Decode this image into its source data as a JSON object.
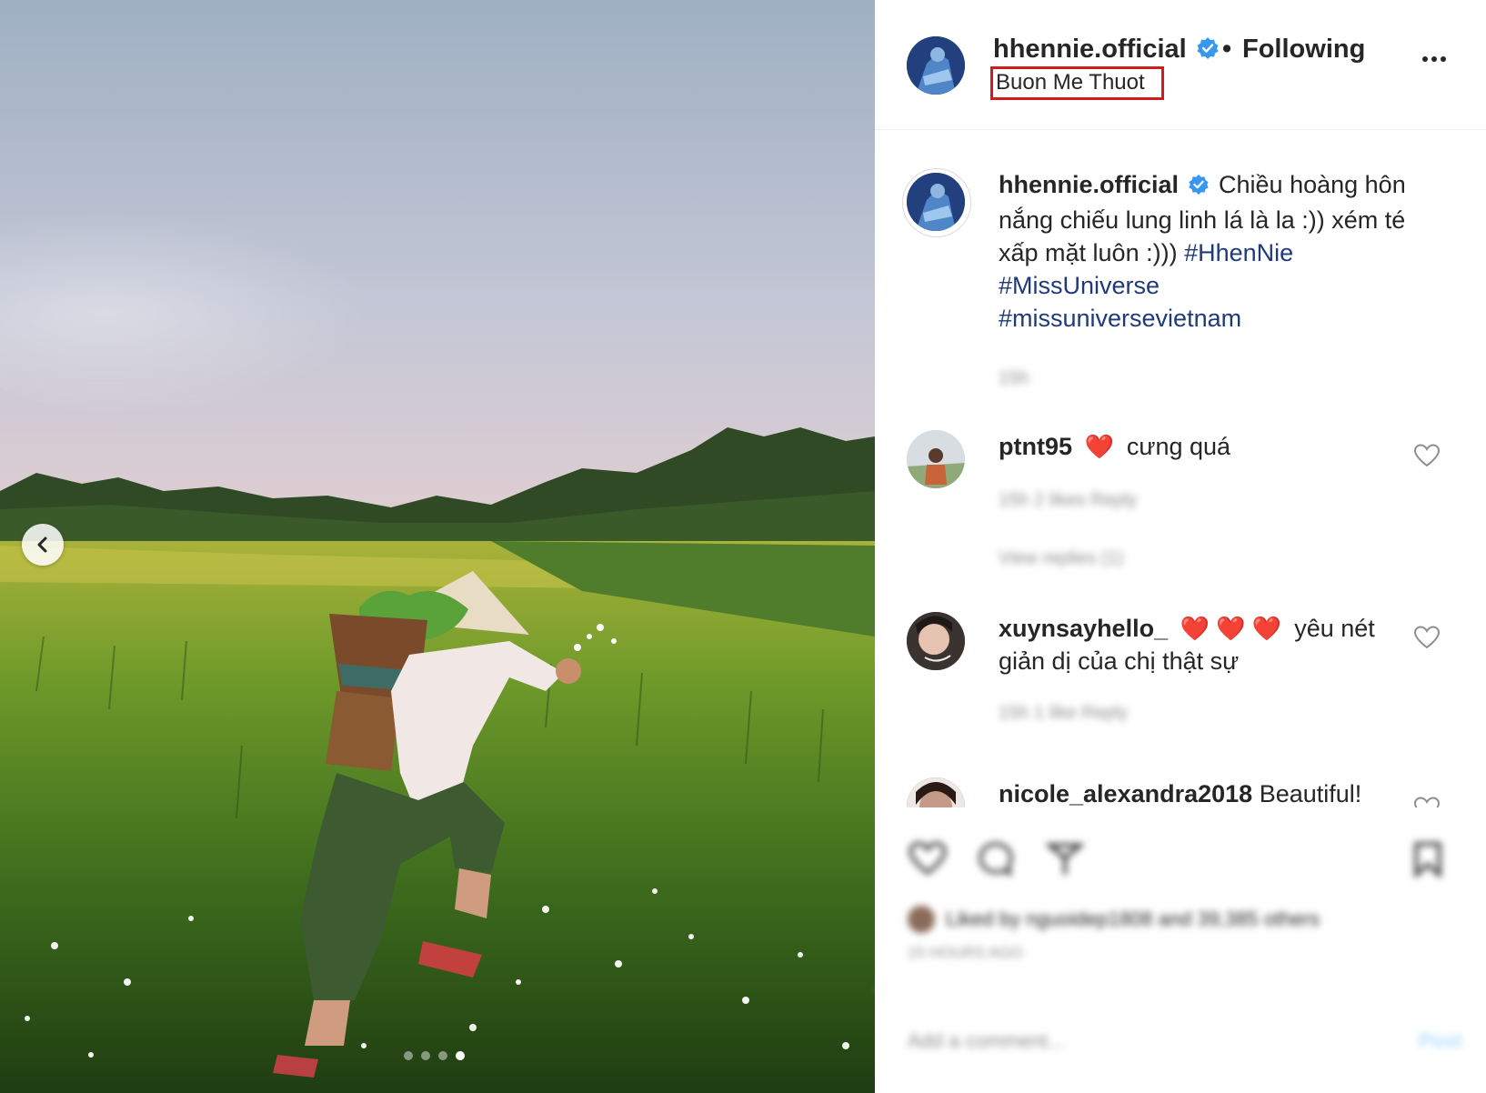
{
  "post": {
    "username": "hhennie.official",
    "bullet": "•",
    "follow_status": "Following",
    "location": "Buon Me Thuot",
    "carousel": {
      "current_index": 4,
      "total": 4
    }
  },
  "caption": {
    "username": "hhennie.official",
    "text_line1": "Chiều hoàng hôn",
    "text_line2": "nắng chiếu lung linh lá là la :)) xém té",
    "text_line3": "xấp mặt luôn :))) ",
    "hashtag1": "#HhenNie",
    "hashtag2": "#MissUniverse",
    "hashtag3": "#missuniversevietnam",
    "time": "15h"
  },
  "comments": [
    {
      "username": "ptnt95",
      "emoji": "❤️",
      "text": "cưng quá",
      "meta": "15h   2 likes   Reply",
      "replies": "View replies (1)"
    },
    {
      "username": "xuynsayhello_",
      "emoji": "❤️ ❤️ ❤️",
      "text_line1": "yêu nét",
      "text_line2": "giản dị của chị thật sự",
      "meta": "15h   1 like   Reply"
    },
    {
      "username": "nicole_alexandra2018",
      "text": "Beautiful!"
    }
  ],
  "footer": {
    "liked_by": "Liked by nguoidep1808 and 39,385 others",
    "time": "15 HOURS AGO",
    "comment_placeholder": "Add a comment...",
    "post_label": "Post"
  },
  "colors": {
    "verified": "#3897f0",
    "hashtag": "#1f3a7a",
    "location_highlight": "#d01c1c",
    "heart": "#e0203a"
  },
  "icons": [
    "chevron-left-icon",
    "verified-badge-icon",
    "more-options-icon",
    "heart-outline-icon",
    "comment-icon",
    "share-icon",
    "bookmark-icon"
  ]
}
